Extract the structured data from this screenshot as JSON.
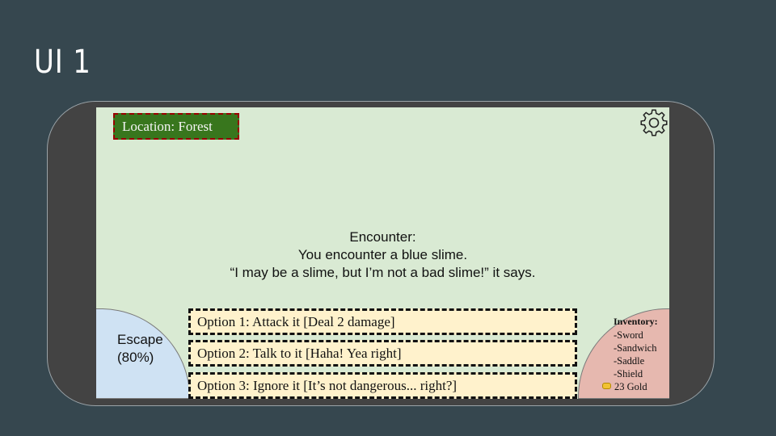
{
  "slide": {
    "title": "UI 1"
  },
  "game": {
    "location_label": "Location: Forest",
    "settings_icon": "gear-icon",
    "encounter": {
      "heading": "Encounter:",
      "line1": "You encounter a blue slime.",
      "line2": "“I may be a slime, but I’m not a bad slime!” it says."
    },
    "escape": {
      "label": "Escape\n(80%)"
    },
    "options": [
      {
        "label": "Option 1: Attack it [Deal 2 damage]"
      },
      {
        "label": "Option 2: Talk to it [Haha! Yea right]"
      },
      {
        "label": "Option 3: Ignore it [It’s not dangerous... right?]"
      }
    ],
    "inventory": {
      "title": "Inventory:",
      "items": [
        "-Sword",
        "-Sandwich",
        "-Saddle",
        "-Shield"
      ],
      "gold_icon": "coin-icon",
      "gold": "23 Gold"
    }
  },
  "colors": {
    "slide_bg": "#36474f",
    "device_bezel": "#434343",
    "screen_bg": "#d9ead3",
    "location_bg": "#38761d",
    "location_border": "#990000",
    "escape_bg": "#cfe2f3",
    "option_bg": "#fff2cc",
    "inventory_bg": "#e6b8af"
  }
}
